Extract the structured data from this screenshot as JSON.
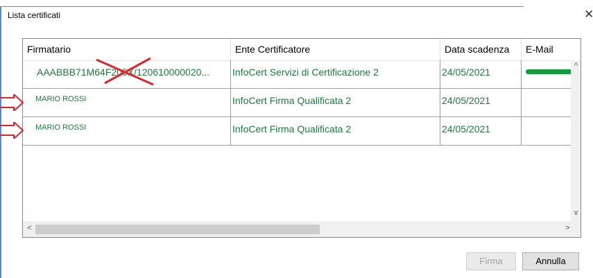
{
  "window": {
    "title": "Lista certificati",
    "close_glyph": "✕"
  },
  "table": {
    "columns": [
      "Firmatario",
      "Ente Certificatore",
      "Data scadenza",
      "E-Mail"
    ],
    "rows": [
      {
        "firmatario": "AAABBB71M64F205X/120610000020...",
        "ente": "InfoCert Servizi di Certificazione 2",
        "scadenza": "24/05/2021",
        "email": ""
      },
      {
        "firmatario": "MARIO ROSSI",
        "ente": "InfoCert Firma Qualificata 2",
        "scadenza": "24/05/2021",
        "email": ""
      },
      {
        "firmatario": "MARIO ROSSI",
        "ente": "InfoCert Firma Qualificata 2",
        "scadenza": "24/05/2021",
        "email": ""
      }
    ]
  },
  "buttons": {
    "firma": "Firma",
    "annulla": "Annulla"
  },
  "scroll": {
    "up": "^",
    "down": "v",
    "left": "<",
    "right": ">"
  },
  "colors": {
    "row_text": "#1e7a3a",
    "annotation_red": "#e0242c",
    "window_border": "#4f8fd6"
  }
}
